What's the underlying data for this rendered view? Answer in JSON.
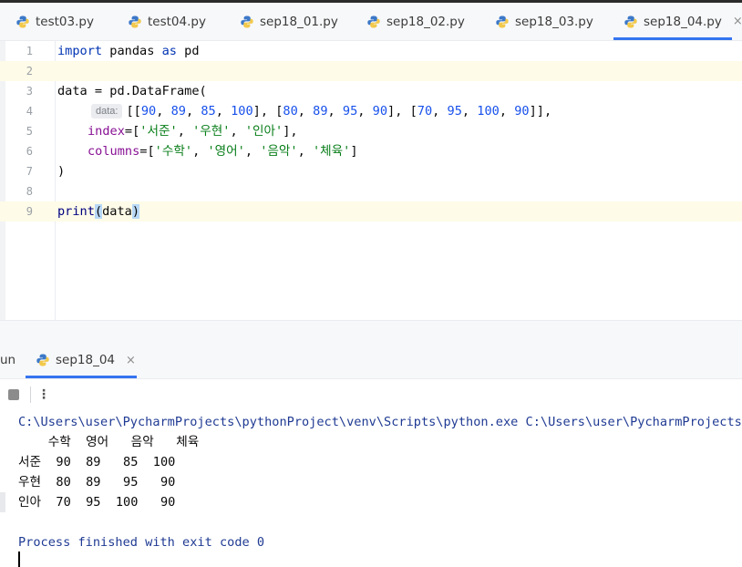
{
  "editor_tabs": [
    {
      "label": "test03.py",
      "active": false
    },
    {
      "label": "test04.py",
      "active": false
    },
    {
      "label": "sep18_01.py",
      "active": false
    },
    {
      "label": "sep18_02.py",
      "active": false
    },
    {
      "label": "sep18_03.py",
      "active": false
    },
    {
      "label": "sep18_04.py",
      "active": true
    }
  ],
  "close_glyph": "×",
  "line_numbers": [
    "1",
    "2",
    "3",
    "4",
    "5",
    "6",
    "7",
    "8",
    "9"
  ],
  "code": {
    "l1_kw1": "import",
    "l1_mid": " pandas ",
    "l1_kw2": "as",
    "l1_end": " pd",
    "l3": "data = pd.DataFrame(",
    "l4_hint": "data:",
    "l4_parts": [
      "[[",
      "90",
      ", ",
      "89",
      ", ",
      "85",
      ", ",
      "100",
      "], [",
      "80",
      ", ",
      "89",
      ", ",
      "95",
      ", ",
      "90",
      "], [",
      "70",
      ", ",
      "95",
      ", ",
      "100",
      ", ",
      "90",
      "]],"
    ],
    "l5_param": "index",
    "l5_eq": "=[",
    "l5_s1": "'서준'",
    "l5_s2": "'우현'",
    "l5_s3": "'인아'",
    "l5_end": "],",
    "l6_param": "columns",
    "l6_eq": "=[",
    "l6_s1": "'수학'",
    "l6_s2": "'영어'",
    "l6_s3": "'음악'",
    "l6_s4": "'체육'",
    "l6_end": "]",
    "l7": ")",
    "l9_fn": "print",
    "l9_open": "(",
    "l9_arg": "data",
    "l9_close": ")"
  },
  "run": {
    "label": "un",
    "tab_label": "sep18_04",
    "command": "C:\\Users\\user\\PycharmProjects\\pythonProject\\venv\\Scripts\\python.exe C:\\Users\\user\\PycharmProjects\\py",
    "table_header": "    수학  영어   음악   체육",
    "rows": [
      "서준  90  89   85  100",
      "우현  80  89   95   90",
      "인아  70  95  100   90"
    ],
    "finished": "Process finished with exit code 0"
  },
  "colors": {
    "accent": "#3574f0",
    "keyword": "#0033b3",
    "number": "#1750eb",
    "string": "#067d17",
    "param": "#871094"
  }
}
